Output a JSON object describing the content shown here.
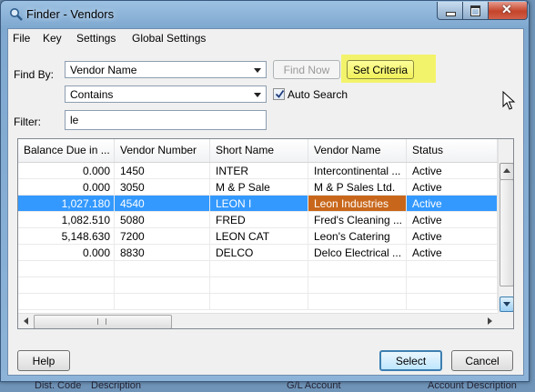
{
  "window": {
    "title": "Finder - Vendors"
  },
  "menu": [
    "File",
    "Key",
    "Settings",
    "Global Settings"
  ],
  "find_by": {
    "label": "Find By:",
    "field": "Vendor Name",
    "operator": "Contains",
    "find_now": "Find Now",
    "set_criteria": "Set Criteria",
    "auto_search": "Auto Search"
  },
  "filter": {
    "label": "Filter:",
    "value": "le"
  },
  "grid": {
    "columns": [
      "Balance Due in ...",
      "Vendor Number",
      "Short Name",
      "Vendor Name",
      "Status"
    ],
    "rows": [
      [
        "0.000",
        "1450",
        "INTER",
        "Intercontinental ...",
        "Active"
      ],
      [
        "0.000",
        "3050",
        "M & P Sale",
        "M & P Sales Ltd.",
        "Active"
      ],
      [
        "1,027.180",
        "4540",
        "LEON I",
        "Leon Industries",
        "Active"
      ],
      [
        "1,082.510",
        "5080",
        "FRED",
        "Fred's Cleaning ...",
        "Active"
      ],
      [
        "5,148.630",
        "7200",
        "LEON CAT",
        "Leon's Catering",
        "Active"
      ],
      [
        "0.000",
        "8830",
        "DELCO",
        "Delco Electrical ...",
        "Active"
      ]
    ],
    "selected_row": 2
  },
  "buttons": {
    "help": "Help",
    "select": "Select",
    "cancel": "Cancel"
  },
  "background": [
    "Dist. Code",
    "Description",
    "G/L Account",
    "Account Description"
  ],
  "colors": {
    "selection": "#3399ff",
    "vendor_highlight": "#c8671b",
    "criteria_highlight": "#f3f36b"
  }
}
